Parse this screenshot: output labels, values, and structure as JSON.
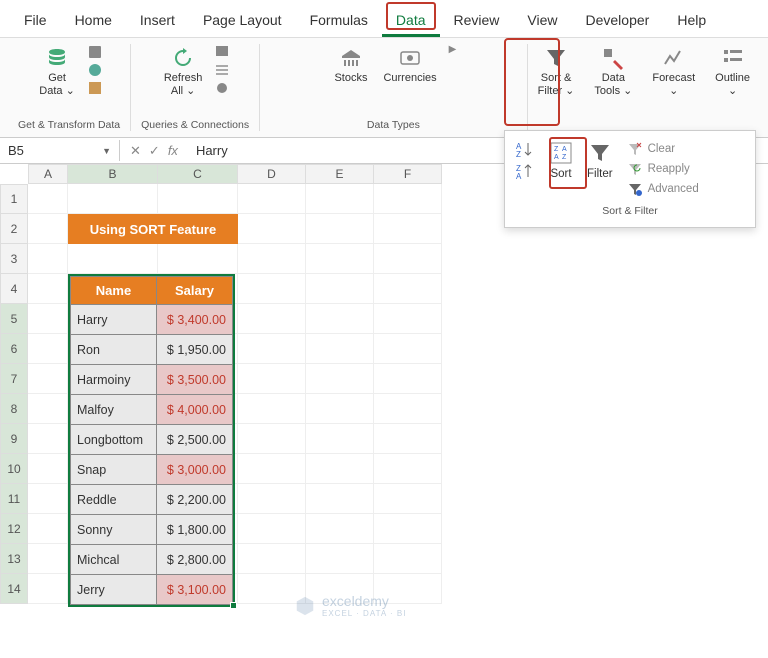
{
  "tabs": [
    "File",
    "Home",
    "Insert",
    "Page Layout",
    "Formulas",
    "Data",
    "Review",
    "View",
    "Developer",
    "Help"
  ],
  "active_tab": "Data",
  "ribbon": {
    "get_data": "Get\nData ⌄",
    "refresh": "Refresh\nAll ⌄",
    "stocks": "Stocks",
    "currencies": "Currencies",
    "sort_filter": "Sort &\nFilter ⌄",
    "data_tools": "Data\nTools ⌄",
    "forecast": "Forecast\n⌄",
    "outline": "Outline\n⌄",
    "g1": "Get & Transform Data",
    "g2": "Queries & Connections",
    "g3": "Data Types"
  },
  "name_box": "B5",
  "formula": "Harry",
  "cols": [
    "A",
    "B",
    "C",
    "D",
    "E",
    "F"
  ],
  "row_nums": [
    1,
    2,
    3,
    4,
    5,
    6,
    7,
    8,
    9,
    10,
    11,
    12,
    13,
    14
  ],
  "title": "Using SORT Feature",
  "headers": {
    "name": "Name",
    "salary": "Salary"
  },
  "data_rows": [
    {
      "name": "Harry",
      "salary": "$ 3,400.00",
      "red": true
    },
    {
      "name": "Ron",
      "salary": "$ 1,950.00",
      "red": false
    },
    {
      "name": "Harmoiny",
      "salary": "$ 3,500.00",
      "red": true
    },
    {
      "name": "Malfoy",
      "salary": "$ 4,000.00",
      "red": true
    },
    {
      "name": "Longbottom",
      "salary": "$ 2,500.00",
      "red": false
    },
    {
      "name": "Snap",
      "salary": "$ 3,000.00",
      "red": true
    },
    {
      "name": "Reddle",
      "salary": "$ 2,200.00",
      "red": false
    },
    {
      "name": "Sonny",
      "salary": "$ 1,800.00",
      "red": false
    },
    {
      "name": "Michcal",
      "salary": "$ 2,800.00",
      "red": false
    },
    {
      "name": "Jerry",
      "salary": "$ 3,100.00",
      "red": true
    }
  ],
  "dropdown": {
    "sort": "Sort",
    "filter": "Filter",
    "clear": "Clear",
    "reapply": "Reapply",
    "advanced": "Advanced",
    "label": "Sort & Filter"
  },
  "watermark": {
    "brand": "exceldemy",
    "sub": "EXCEL · DATA · BI"
  }
}
